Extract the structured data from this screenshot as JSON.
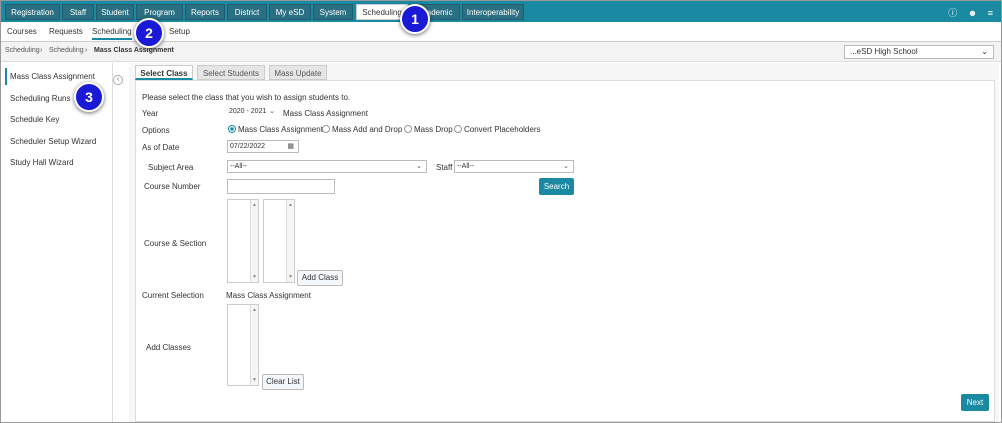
{
  "topnav": {
    "tabs": [
      {
        "label": "Registration"
      },
      {
        "label": "Staff"
      },
      {
        "label": "Student"
      },
      {
        "label": "Program"
      },
      {
        "label": "Reports"
      },
      {
        "label": "District"
      },
      {
        "label": "My eSD"
      },
      {
        "label": "System"
      },
      {
        "label": "Scheduling",
        "active": true
      },
      {
        "label": "Academic"
      },
      {
        "label": "Interoperability"
      }
    ]
  },
  "subnav": {
    "items": [
      "Courses",
      "Requests",
      "Scheduling",
      "Setup"
    ]
  },
  "breadcrumb": {
    "items": [
      "Scheduling",
      "Scheduling",
      "Mass Class Assignment"
    ]
  },
  "school": {
    "selected": "...eSD High School"
  },
  "sidebar": {
    "items": [
      "Mass Class Assignment",
      "Scheduling Runs",
      "Schedule Key",
      "Scheduler Setup Wizard",
      "Study Hall Wizard"
    ]
  },
  "content_tabs": [
    "Select Class",
    "Select Students",
    "Mass Update"
  ],
  "form": {
    "instruction": "Please select the class that you wish to assign students to.",
    "year_label": "Year",
    "year_value": "2020 - 2021",
    "year_note": "Mass Class Assignment",
    "options_label": "Options",
    "options": [
      "Mass Class Assignment",
      "Mass Add and Drop",
      "Mass Drop",
      "Convert Placeholders"
    ],
    "as_of_label": "As of Date",
    "as_of_value": "07/22/2022",
    "subject_label": "Subject Area",
    "subject_value": "--All--",
    "staff_label": "Staff",
    "staff_value": "--All--",
    "course_number_label": "Course Number",
    "search_label": "Search",
    "course_section_label": "Course & Section",
    "add_class_label": "Add Class",
    "current_selection_label": "Current Selection",
    "current_selection_value": "Mass Class Assignment",
    "add_classes_label": "Add Classes",
    "clear_list_label": "Clear List",
    "next_label": "Next"
  },
  "markers": [
    "1",
    "2",
    "3"
  ],
  "colors": {
    "accent": "#1a8aa2",
    "marker": "#1a1ad6"
  }
}
